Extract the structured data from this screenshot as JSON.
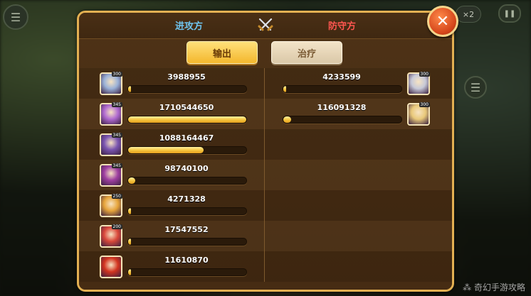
{
  "header": {
    "attack_label": "进攻方",
    "defend_label": "防守方",
    "swords_icon": "crossed-swords-icon"
  },
  "tabs": {
    "output_label": "输出",
    "heal_label": "治疗",
    "selected": "output"
  },
  "close": {
    "icon": "close-x-icon",
    "glyph": "✕"
  },
  "attackers": [
    {
      "value": "3988955",
      "fraction": 0.0023,
      "level": "300",
      "color": "#9ab1d8"
    },
    {
      "value": "1710544650",
      "fraction": 1.0,
      "level": "345",
      "color": "#b06ad0"
    },
    {
      "value": "1088164467",
      "fraction": 0.636,
      "level": "345",
      "color": "#7a55b0"
    },
    {
      "value": "98740100",
      "fraction": 0.058,
      "level": "345",
      "color": "#9e3fa0"
    },
    {
      "value": "4271328",
      "fraction": 0.0025,
      "level": "250",
      "color": "#e6a43a"
    },
    {
      "value": "17547552",
      "fraction": 0.0103,
      "level": "200",
      "color": "#d9483a"
    },
    {
      "value": "11610870",
      "fraction": 0.0068,
      "level": "",
      "color": "#d2341f"
    }
  ],
  "defenders": [
    {
      "value": "4233599",
      "fraction": 0.0025,
      "level": "300",
      "color": "#c7c9d8"
    },
    {
      "value": "116091328",
      "fraction": 0.068,
      "level": "300",
      "color": "#e9c97a"
    }
  ],
  "background": {
    "menu_glyph": "☰",
    "pause_glyph": "❚❚",
    "speed_label": "×2",
    "list_glyph": "☰"
  },
  "watermark": "⁂ 奇幻手游攻略"
}
